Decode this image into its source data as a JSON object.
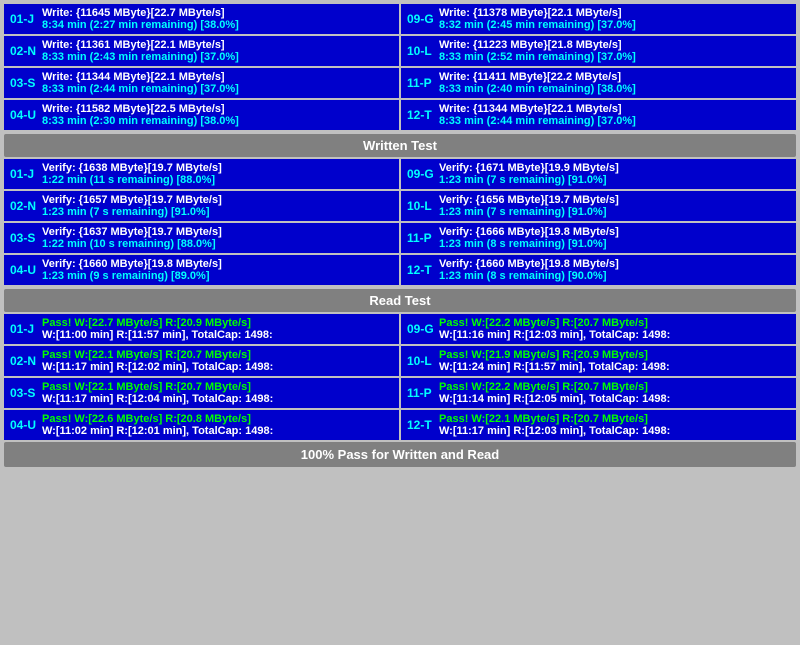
{
  "sections": {
    "write": {
      "label": "Written Test",
      "left": [
        {
          "id": "01-J",
          "line1": "Write: {11645 MByte}[22.7 MByte/s]",
          "line2": "8:34 min (2:27 min remaining)  [38.0%]"
        },
        {
          "id": "02-N",
          "line1": "Write: {11361 MByte}[22.1 MByte/s]",
          "line2": "8:33 min (2:43 min remaining)  [37.0%]"
        },
        {
          "id": "03-S",
          "line1": "Write: {11344 MByte}[22.1 MByte/s]",
          "line2": "8:33 min (2:44 min remaining)  [37.0%]"
        },
        {
          "id": "04-U",
          "line1": "Write: {11582 MByte}[22.5 MByte/s]",
          "line2": "8:33 min (2:30 min remaining)  [38.0%]"
        }
      ],
      "right": [
        {
          "id": "09-G",
          "line1": "Write: {11378 MByte}[22.1 MByte/s]",
          "line2": "8:32 min (2:45 min remaining)  [37.0%]"
        },
        {
          "id": "10-L",
          "line1": "Write: {11223 MByte}[21.8 MByte/s]",
          "line2": "8:33 min (2:52 min remaining)  [37.0%]"
        },
        {
          "id": "11-P",
          "line1": "Write: {11411 MByte}[22.2 MByte/s]",
          "line2": "8:33 min (2:40 min remaining)  [38.0%]"
        },
        {
          "id": "12-T",
          "line1": "Write: {11344 MByte}[22.1 MByte/s]",
          "line2": "8:33 min (2:44 min remaining)  [37.0%]"
        }
      ]
    },
    "verify": {
      "label": "Written Test",
      "left": [
        {
          "id": "01-J",
          "line1": "Verify: {1638 MByte}[19.7 MByte/s]",
          "line2": "1:22 min (11 s remaining)  [88.0%]"
        },
        {
          "id": "02-N",
          "line1": "Verify: {1657 MByte}[19.7 MByte/s]",
          "line2": "1:23 min (7 s remaining)  [91.0%]"
        },
        {
          "id": "03-S",
          "line1": "Verify: {1637 MByte}[19.7 MByte/s]",
          "line2": "1:22 min (10 s remaining)  [88.0%]"
        },
        {
          "id": "04-U",
          "line1": "Verify: {1660 MByte}[19.8 MByte/s]",
          "line2": "1:23 min (9 s remaining)  [89.0%]"
        }
      ],
      "right": [
        {
          "id": "09-G",
          "line1": "Verify: {1671 MByte}[19.9 MByte/s]",
          "line2": "1:23 min (7 s remaining)  [91.0%]"
        },
        {
          "id": "10-L",
          "line1": "Verify: {1656 MByte}[19.7 MByte/s]",
          "line2": "1:23 min (7 s remaining)  [91.0%]"
        },
        {
          "id": "11-P",
          "line1": "Verify: {1666 MByte}[19.8 MByte/s]",
          "line2": "1:23 min (8 s remaining)  [91.0%]"
        },
        {
          "id": "12-T",
          "line1": "Verify: {1660 MByte}[19.8 MByte/s]",
          "line2": "1:23 min (8 s remaining)  [90.0%]"
        }
      ]
    },
    "read": {
      "label": "Read Test",
      "left": [
        {
          "id": "01-J",
          "line1": "Pass! W:[22.7 MByte/s] R:[20.9 MByte/s]",
          "line2": "W:[11:00 min] R:[11:57 min], TotalCap: 1498:"
        },
        {
          "id": "02-N",
          "line1": "Pass! W:[22.1 MByte/s] R:[20.7 MByte/s]",
          "line2": "W:[11:17 min] R:[12:02 min], TotalCap: 1498:"
        },
        {
          "id": "03-S",
          "line1": "Pass! W:[22.1 MByte/s] R:[20.7 MByte/s]",
          "line2": "W:[11:17 min] R:[12:04 min], TotalCap: 1498:"
        },
        {
          "id": "04-U",
          "line1": "Pass! W:[22.6 MByte/s] R:[20.8 MByte/s]",
          "line2": "W:[11:02 min] R:[12:01 min], TotalCap: 1498:"
        }
      ],
      "right": [
        {
          "id": "09-G",
          "line1": "Pass! W:[22.2 MByte/s] R:[20.7 MByte/s]",
          "line2": "W:[11:16 min] R:[12:03 min], TotalCap: 1498:"
        },
        {
          "id": "10-L",
          "line1": "Pass! W:[21.9 MByte/s] R:[20.9 MByte/s]",
          "line2": "W:[11:24 min] R:[11:57 min], TotalCap: 1498:"
        },
        {
          "id": "11-P",
          "line1": "Pass! W:[22.2 MByte/s] R:[20.7 MByte/s]",
          "line2": "W:[11:14 min] R:[12:05 min], TotalCap: 1498:"
        },
        {
          "id": "12-T",
          "line1": "Pass! W:[22.1 MByte/s] R:[20.7 MByte/s]",
          "line2": "W:[11:17 min] R:[12:03 min], TotalCap: 1498:"
        }
      ]
    }
  },
  "labels": {
    "written_test": "Written Test",
    "read_test": "Read Test",
    "final": "100% Pass for Written and Read"
  }
}
